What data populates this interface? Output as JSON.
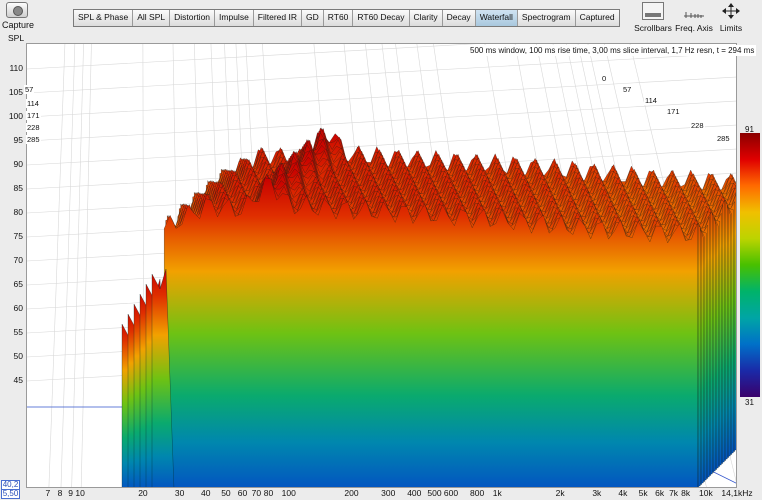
{
  "toolbar": {
    "capture_label": "Capture",
    "tabs": [
      "SPL & Phase",
      "All SPL",
      "Distortion",
      "Impulse",
      "Filtered IR",
      "GD",
      "RT60",
      "RT60 Decay",
      "Clarity",
      "Decay",
      "Waterfall",
      "Spectrogram",
      "Captured"
    ],
    "active_tab": "Waterfall",
    "scrollbars_label": "Scrollbars",
    "freq_axis_label": "Freq. Axis",
    "limits_label": "Limits"
  },
  "info_text": "500 ms window, 100 ms rise time, 3,00 ms slice interval, 1,7 Hz resn, t = 294 ms",
  "axis_boxes": {
    "x_min": "5,50",
    "y_min": "40,2"
  },
  "color_scale": {
    "max": "91",
    "min": "31"
  },
  "slice_labels": [
    "0",
    "57",
    "114",
    "171",
    "228",
    "285"
  ],
  "chart_data": {
    "type": "area",
    "title": "",
    "ylabel": "SPL",
    "xlabel": "",
    "x_scale": "log",
    "y_ticks": [
      "110",
      "105",
      "100",
      "95",
      "90",
      "85",
      "80",
      "75",
      "70",
      "65",
      "60",
      "55",
      "50",
      "45"
    ],
    "x_ticks": [
      "7",
      "8",
      "9",
      "10",
      "20",
      "30",
      "40",
      "50",
      "60",
      "70",
      "80",
      "100",
      "200",
      "300",
      "400",
      "500",
      "600",
      "800",
      "1k",
      "2k",
      "3k",
      "4k",
      "5k",
      "6k",
      "7k",
      "8k",
      "10k",
      "14,1kHz"
    ],
    "ylim": [
      40.2,
      112
    ],
    "xlim": [
      5.5,
      14100
    ],
    "time_slices_ms": [
      0,
      57,
      114,
      171,
      228,
      285
    ],
    "front_slice_peak_spl": [
      {
        "x": 30,
        "y": 87
      },
      {
        "x": 40,
        "y": 90
      },
      {
        "x": 60,
        "y": 89
      },
      {
        "x": 80,
        "y": 95
      },
      {
        "x": 100,
        "y": 90
      },
      {
        "x": 200,
        "y": 89
      },
      {
        "x": 500,
        "y": 88
      },
      {
        "x": 1000,
        "y": 87
      },
      {
        "x": 3000,
        "y": 85
      },
      {
        "x": 8000,
        "y": 84
      }
    ],
    "colorbar_range": [
      31,
      91
    ],
    "grid": true
  }
}
